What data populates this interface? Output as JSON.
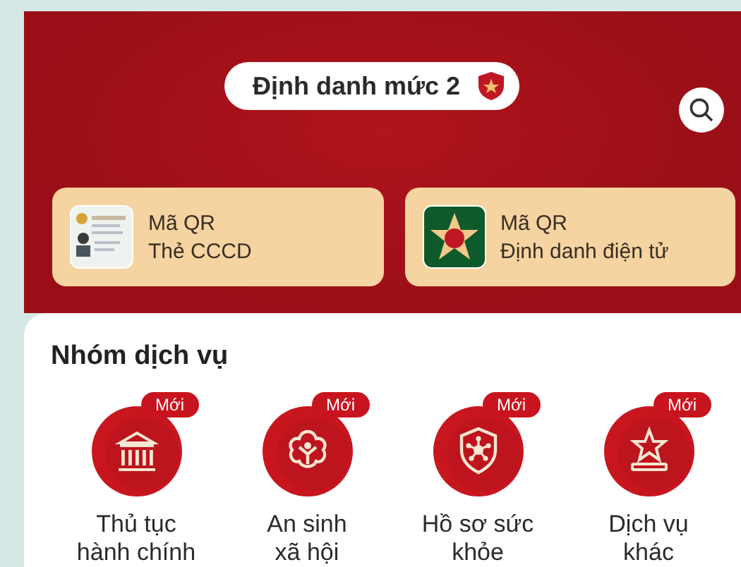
{
  "header": {
    "level_badge": "Định danh mức 2"
  },
  "qr_cards": [
    {
      "kind": "id-card",
      "title": "Mã QR",
      "subtitle": "Thẻ CCCD"
    },
    {
      "kind": "emblem",
      "title": "Mã QR",
      "subtitle": "Định danh điện tử"
    }
  ],
  "services": {
    "title": "Nhóm dịch vụ",
    "items": [
      {
        "kind": "building",
        "badge": "Mới",
        "label": "Thủ tục\nhành chính"
      },
      {
        "kind": "flower",
        "badge": "Mới",
        "label": "An sinh\nxã hội"
      },
      {
        "kind": "shield",
        "badge": "Mới",
        "label": "Hồ sơ sức\nkhỏe"
      },
      {
        "kind": "star",
        "badge": "Mới",
        "label": "Dịch vụ\nkhác"
      }
    ]
  }
}
